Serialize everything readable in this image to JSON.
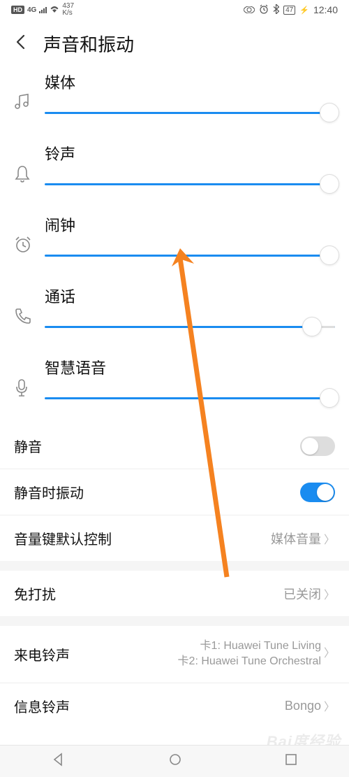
{
  "status": {
    "hd": "HD",
    "network": "4G",
    "speed_num": "437",
    "speed_unit": "K/s",
    "battery": "47",
    "time": "12:40"
  },
  "header": {
    "title": "声音和振动"
  },
  "sliders": [
    {
      "label": "媒体",
      "icon": "music",
      "value": 100
    },
    {
      "label": "铃声",
      "icon": "bell",
      "value": 100
    },
    {
      "label": "闹钟",
      "icon": "alarm",
      "value": 100
    },
    {
      "label": "通话",
      "icon": "phone",
      "value": 92
    },
    {
      "label": "智慧语音",
      "icon": "mic",
      "value": 100
    }
  ],
  "settings": {
    "mute": {
      "label": "静音",
      "on": false
    },
    "vibrate_when_mute": {
      "label": "静音时振动",
      "on": true
    },
    "volume_key_control": {
      "label": "音量键默认控制",
      "value": "媒体音量"
    },
    "dnd": {
      "label": "免打扰",
      "value": "已关闭"
    },
    "ringtone": {
      "label": "来电铃声",
      "line1": "卡1: Huawei Tune Living",
      "line2": "卡2: Huawei Tune Orchestral"
    },
    "message_tone": {
      "label": "信息铃声",
      "value": "Bongo"
    }
  },
  "watermark": "Bai度经验"
}
